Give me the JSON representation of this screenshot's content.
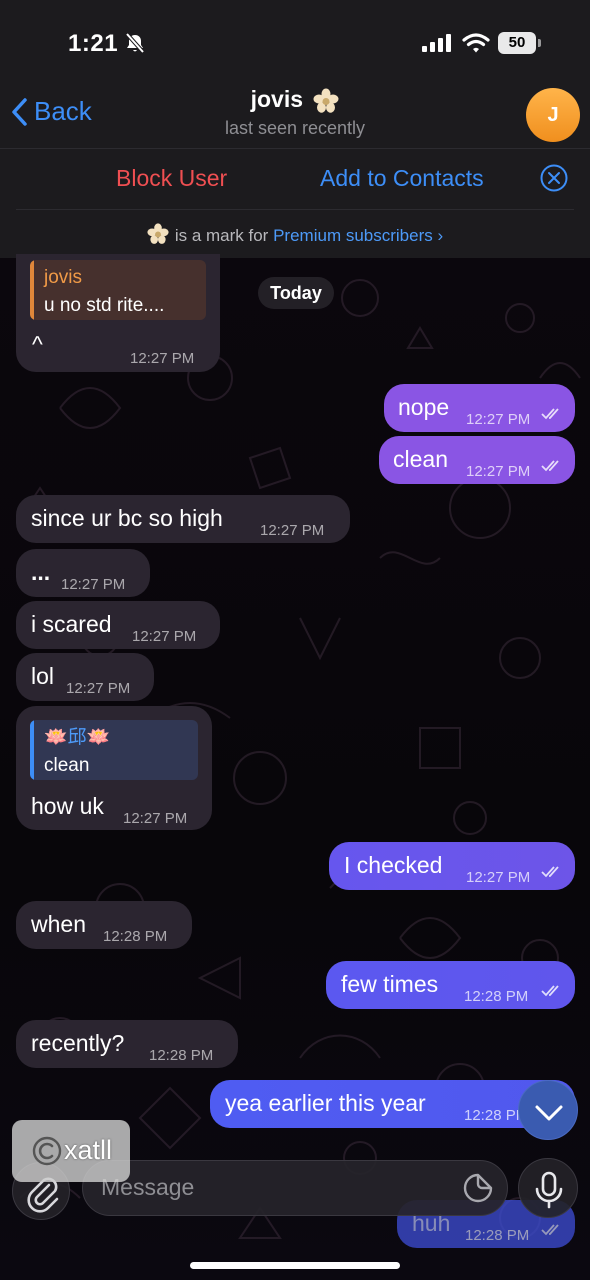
{
  "status_bar": {
    "time": "1:21",
    "battery": "50"
  },
  "header": {
    "back_label": "Back",
    "contact_name": "jovis",
    "contact_status": "last seen recently",
    "avatar_initial": "J"
  },
  "action_bar": {
    "block_label": "Block User",
    "add_contact_label": "Add to Contacts",
    "premium_note": "is a mark for",
    "premium_link": "Premium subscribers"
  },
  "date_separator": "Today",
  "messages": [
    {
      "dir": "in",
      "reply_author": "jovis",
      "reply_text": "u no std rite....",
      "text": "^",
      "time": "12:27 PM"
    },
    {
      "dir": "out",
      "text": "nope",
      "time": "12:27 PM"
    },
    {
      "dir": "out",
      "text": "clean",
      "time": "12:27 PM"
    },
    {
      "dir": "in",
      "text": "since ur bc so high",
      "time": "12:27 PM"
    },
    {
      "dir": "in",
      "text": "...",
      "time": "12:27 PM"
    },
    {
      "dir": "in",
      "text": "i scared",
      "time": "12:27 PM"
    },
    {
      "dir": "in",
      "text": "lol",
      "time": "12:27 PM"
    },
    {
      "dir": "in",
      "reply_author": "🪷邱🪷",
      "reply_text": "clean",
      "text": "how uk",
      "time": "12:27 PM"
    },
    {
      "dir": "out",
      "text": "I checked",
      "time": "12:27 PM"
    },
    {
      "dir": "in",
      "text": "when",
      "time": "12:28 PM"
    },
    {
      "dir": "out",
      "text": "few times",
      "time": "12:28 PM"
    },
    {
      "dir": "in",
      "text": "recently?",
      "time": "12:28 PM"
    },
    {
      "dir": "out",
      "text": "yea earlier this year",
      "time": "12:28 PM"
    },
    {
      "dir": "out",
      "text": "huh",
      "time": "12:28 PM"
    }
  ],
  "composer": {
    "placeholder": "Message"
  },
  "watermark": {
    "text": "xatll"
  },
  "icons": {
    "back": "chevron-left-icon",
    "muted": "bell-slash-icon",
    "close": "close-circle-icon",
    "attach": "paperclip-icon",
    "sticker": "sticker-icon",
    "mic": "microphone-icon",
    "scroll": "chevron-down-icon",
    "read": "double-check-icon"
  },
  "colors": {
    "accent": "#3d8ef7",
    "danger": "#ef4f52",
    "outgoing": "#6a58ee",
    "incoming": "#2b2530"
  }
}
